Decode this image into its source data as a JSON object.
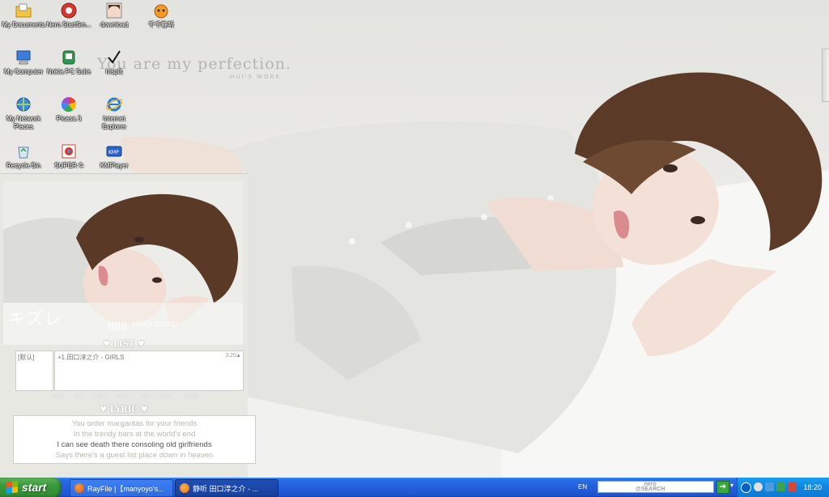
{
  "desktop": {
    "icons": [
      {
        "label": "My Documents",
        "icon": "folder-documents-icon"
      },
      {
        "label": "Nero StartSm...",
        "icon": "nero-icon"
      },
      {
        "label": "download",
        "icon": "photo-icon"
      },
      {
        "label": "千千静听",
        "icon": "ttplayer-icon"
      },
      {
        "label": "My Computer",
        "icon": "computer-icon"
      },
      {
        "label": "Nokia PC Suite",
        "icon": "nokia-icon"
      },
      {
        "label": "hisplit",
        "icon": "checkmark-icon"
      },
      {
        "label": "My Network Places",
        "icon": "network-icon"
      },
      {
        "label": "Picasa 3",
        "icon": "picasa-icon"
      },
      {
        "label": "Internet Explorer",
        "icon": "ie-icon"
      },
      {
        "label": "Recycle Bin",
        "icon": "recycle-bin-icon"
      },
      {
        "label": "SUPER ©",
        "icon": "super-icon"
      },
      {
        "label": "KMPlayer",
        "icon": "kmplayer-icon"
      }
    ]
  },
  "wallpaper": {
    "tagline": "You are my perfection.",
    "subtag": "HUI'S WORK"
  },
  "player": {
    "art_text": "キズレ",
    "art_sub": "HAIRS SOUND",
    "list_heading": "LIST",
    "playlist_name": "[默认]",
    "track_title": "+1.田口淳之介 - GIRLS",
    "track_time": "3:20",
    "controls": [
      "ADD",
      "DEL",
      "LIST",
      "MISC",
      "SEE",
      "EXIT",
      "MODE"
    ],
    "lyric_heading": "LYRIC",
    "lyrics": [
      "You order margaritas for your friends",
      "In the trendy bars at the world's end",
      "I can see death there consoling old girlfriends",
      "Says there's a guest list place down in heaven"
    ],
    "current_lyric_index": 2
  },
  "taskbar": {
    "start_label": "start",
    "tasks": [
      {
        "label": "RayFile |【manyoyo's...",
        "icon": "firefox-icon",
        "active": false
      },
      {
        "label": "静听  田口淳之介 - ...",
        "icon": "ttplayer-icon",
        "active": true
      }
    ],
    "language": "EN",
    "search_logo": "nero\n@SEARCH",
    "clock": "18:20"
  },
  "colors": {
    "taskbar_blue": "#245edb",
    "start_green": "#3a9a3b",
    "tray_blue": "#0f8ae2",
    "player_bg": "#e8e8e3"
  }
}
